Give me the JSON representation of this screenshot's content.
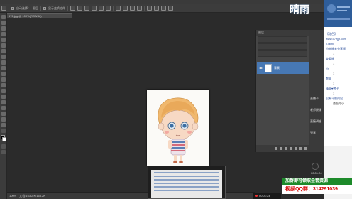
{
  "options_bar": {
    "auto_select_label": "自动选择：",
    "layer_select": "图层",
    "show_transform_label": "显示变换控件"
  },
  "document": {
    "tab_label": "676.jpg @ 100%(RGB/8#)",
    "zoom": "100%",
    "doc_size": "文档:163.2 K/163.2K"
  },
  "layers_panel": {
    "tab_label": "图层",
    "layer_name": "背景"
  },
  "watermark": {
    "logo": "晴雨"
  },
  "chat": {
    "header": "【花色】",
    "lines": [
      {
        "text": "www.57ejjh.com",
        "type": "link"
      },
      {
        "text": ".[.htm]",
        "type": "link"
      },
      {
        "text": "特幸福来分享领",
        "type": "msg"
      },
      {
        "text": "1",
        "type": "num"
      },
      {
        "text": "查看福",
        "type": "msg"
      },
      {
        "text": "1",
        "type": "num"
      },
      {
        "text": "特",
        "type": "msg"
      },
      {
        "text": "1",
        "type": "num"
      },
      {
        "text": "数量",
        "type": "msg"
      },
      {
        "text": "1",
        "type": "num"
      },
      {
        "text": "精量♥鸭子",
        "type": "msg"
      },
      {
        "text": "1",
        "type": "num"
      },
      {
        "text": "没有马前列出",
        "type": "msg"
      },
      {
        "text": "查面你小",
        "type": "msg"
      }
    ],
    "time": "00:01:24"
  },
  "side_labels": {
    "a": "直播卡",
    "b": "老师授课",
    "c": "直接讲座",
    "d": "分享"
  },
  "promo": "加群即可领取全套资源",
  "qq_label": "视频QQ群：314291039",
  "player_time": "00:01:24"
}
